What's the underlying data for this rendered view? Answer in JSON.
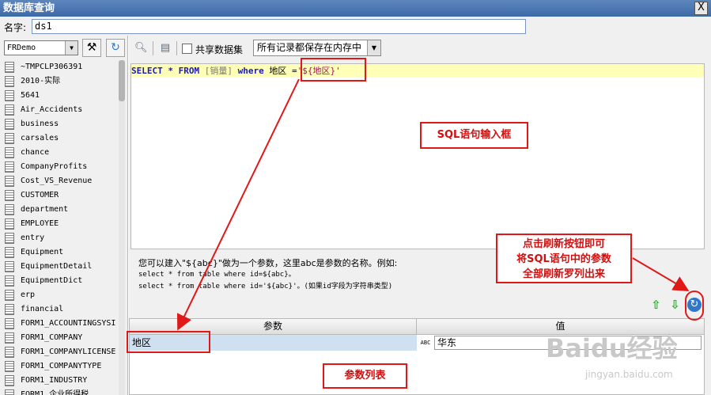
{
  "window": {
    "title": "数据库查询",
    "close_label": "X"
  },
  "name_bar": {
    "label": "名字:",
    "value": "ds1"
  },
  "left": {
    "datasource": "FRDemo",
    "tables": [
      "~TMPCLP306391",
      "2010-实际",
      "5641",
      "Air_Accidents",
      "business",
      "carsales",
      "chance",
      "CompanyProfits",
      "Cost_VS_Revenue",
      "CUSTOMER",
      "department",
      "EMPLOYEE",
      "entry",
      "Equipment",
      "EquipmentDetail",
      "EquipmentDict",
      "erp",
      "financial",
      "FORM1_ACCOUNTINGSYSI",
      "FORM1_COMPANY",
      "FORM1_COMPANYLICENSE",
      "FORM1_COMPANYTYPE",
      "FORM1_INDUSTRY",
      "FORM1_企业所得税"
    ]
  },
  "toolbar": {
    "share_label": "共享数据集",
    "mode_select": "所有记录都保存在内存中"
  },
  "sql": {
    "t1": "SELECT * FROM ",
    "t2": "[销量]",
    "t3": " where ",
    "t4": "地区",
    "t5": " =",
    "t6": "'${地区}'"
  },
  "hint": {
    "line1": "您可以建入\"${abc}\"做为一个参数，这里abc是参数的名称。例如:",
    "line2": "select * from table where id=${abc}。",
    "line3": "select * from table where id='${abc}'。(如果id字段为字符串类型)"
  },
  "params": {
    "col_name": "参数",
    "col_value": "值",
    "rows": [
      {
        "name": "地区",
        "type": "ABC",
        "value": "华东"
      }
    ]
  },
  "annotations": {
    "sql_box": "SQL语句输入框",
    "refresh_1": "点击刷新按钮即可",
    "refresh_2": "将SQL语句中的参数",
    "refresh_3": "全部刷新罗列出来",
    "params": "参数列表"
  },
  "watermark": {
    "main": "Baidu经验",
    "sub": "jingyan.baidu.com"
  },
  "colors": {
    "annotation": "#e01818",
    "titlebar": "#4a76b2"
  }
}
